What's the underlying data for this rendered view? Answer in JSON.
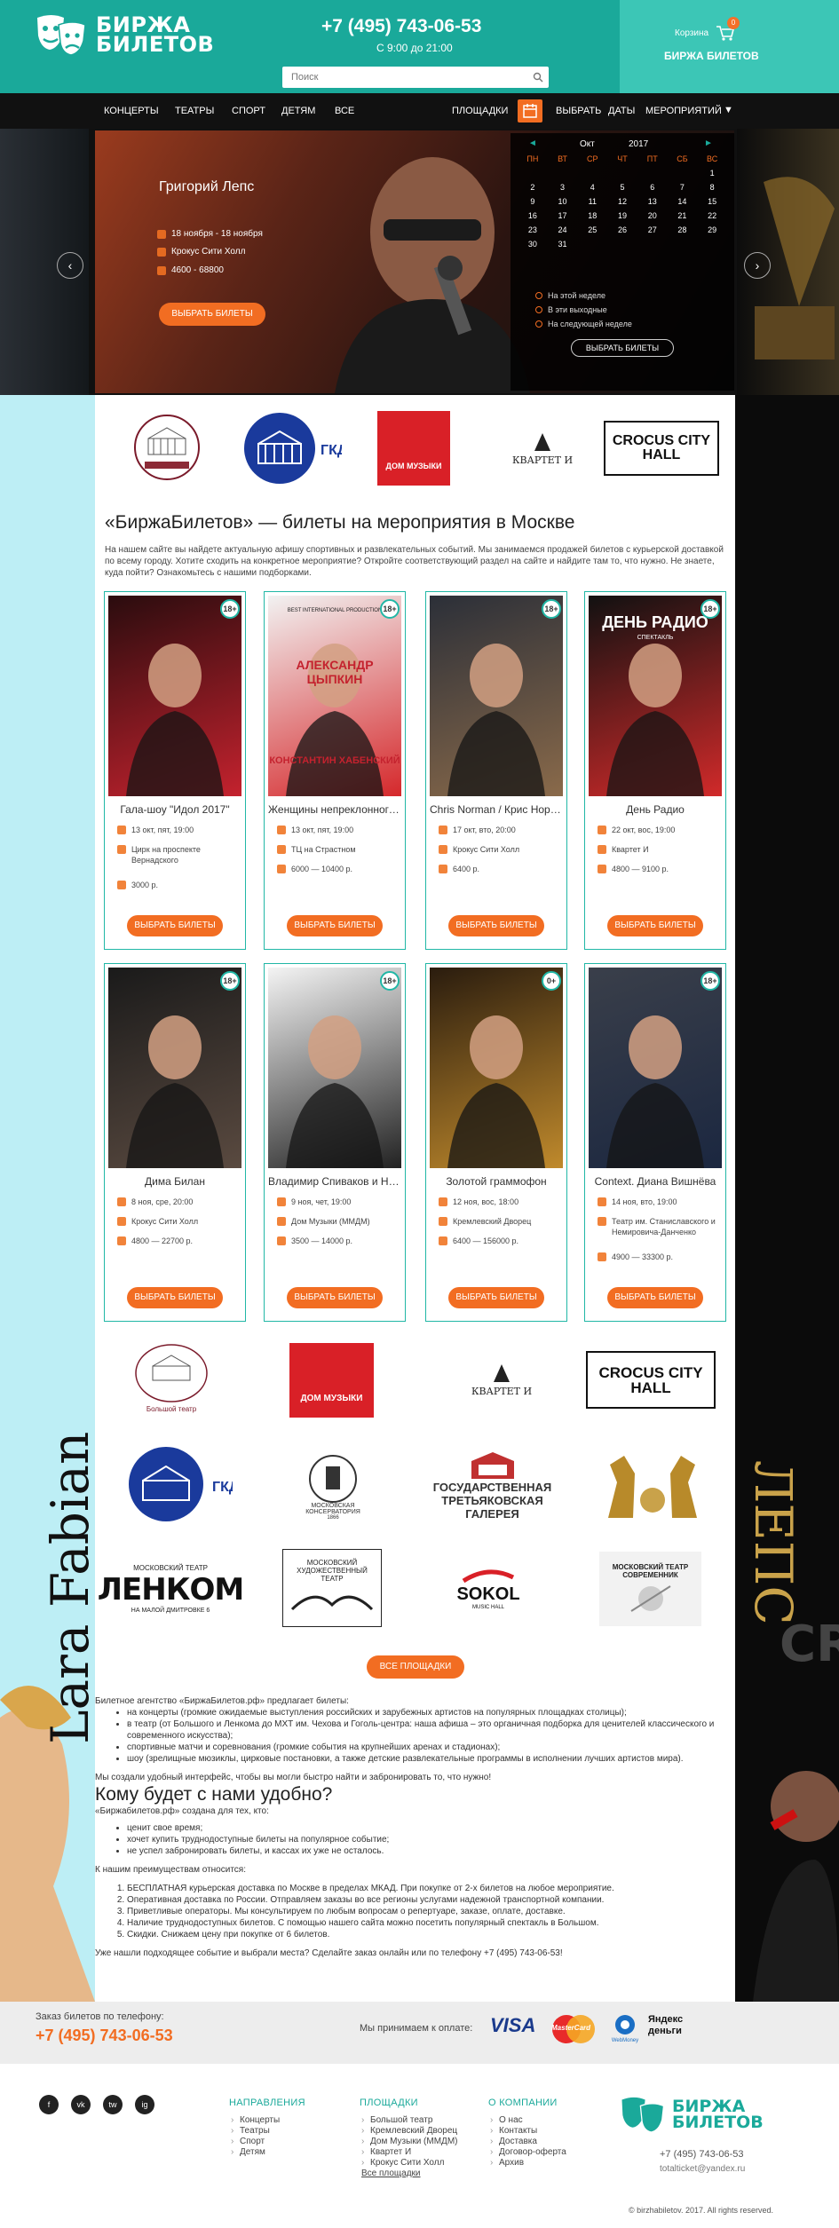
{
  "brand": {
    "name_line1": "БИРЖА",
    "name_line2": "БИЛЕТОВ"
  },
  "header": {
    "phone": "+7 (495) 743-06-53",
    "hours": "С 9:00 до 21:00",
    "search_placeholder": "Поиск",
    "cart_label": "Корзина",
    "cart_count": "0",
    "cart_brand": "БИРЖА БИЛЕТОВ"
  },
  "nav": {
    "items": [
      "КОНЦЕРТЫ",
      "ТЕАТРЫ",
      "СПОРТ",
      "ДЕТЯМ",
      "ВСЕ",
      "ПЛОЩАДКИ"
    ],
    "pick": "ВЫБРАТЬ",
    "dates": "ДАТЫ",
    "events": "МЕРОПРИЯТИЙ"
  },
  "hero": {
    "title": "Григорий Лепс",
    "dates": "18 ноября - 18 ноября",
    "venue": "Крокус Сити Холл",
    "price": "4600 - 68800",
    "button": "ВЫБРАТЬ БИЛЕТЫ"
  },
  "calendar": {
    "month": "Окт",
    "year": "2017",
    "days": [
      "ПН",
      "ВТ",
      "СР",
      "ЧТ",
      "ПТ",
      "СБ",
      "ВС"
    ],
    "cells": [
      "",
      "",
      "",
      "",
      "",
      "",
      "1",
      "2",
      "3",
      "4",
      "5",
      "6",
      "7",
      "8",
      "9",
      "10",
      "11",
      "12",
      "13",
      "14",
      "15",
      "16",
      "17",
      "18",
      "19",
      "20",
      "21",
      "22",
      "23",
      "24",
      "25",
      "26",
      "27",
      "28",
      "29",
      "30",
      "31",
      "",
      "",
      "",
      "",
      ""
    ],
    "options": [
      "На этой неделе",
      "В эти выходные",
      "На следующей неделе"
    ],
    "button": "ВЫБРАТЬ БИЛЕТЫ"
  },
  "venues_top": [
    "Большой театр",
    "ГКД",
    "ДОМ МУЗЫКИ",
    "КВАРТЕТ И",
    "CROCUS CITY HALL"
  ],
  "intro": {
    "heading": "«БиржаБилетов» — билеты на мероприятия в Москве",
    "text": "На нашем сайте вы найдете актуальную афишу спортивных и развлекательных событий. Мы занимаемся продажей билетов с курьерской доставкой по всему городу. Хотите сходить на конкретное мероприятие? Откройте соответствующий раздел на сайте и найдите там то, что нужно. Не знаете, куда пойти? Ознакомьтесь с нашими подборками."
  },
  "cards": [
    {
      "age": "18+",
      "title": "Гала-шоу \"Идол 2017\"",
      "date": "13 окт, пят, 19:00",
      "venue": "Цирк на проспекте Вернадского",
      "price": "3000 р.",
      "button": "ВЫБРАТЬ БИЛЕТЫ"
    },
    {
      "age": "18+",
      "title": "Женщины непреклонного возраста",
      "date": "13 окт, пят, 19:00",
      "venue": "ТЦ на Страстном",
      "price": "6000 — 10400 р.",
      "button": "ВЫБРАТЬ БИЛЕТЫ",
      "poster_top": "BEST INTERNATIONAL PRODUCTION",
      "poster_name": "АЛЕКСАНДР ЦЫПКИН",
      "poster_name2": "КОНСТАНТИН ХАБЕНСКИЙ"
    },
    {
      "age": "18+",
      "title": "Chris Norman / Крис Норман",
      "date": "17 окт, вто, 20:00",
      "venue": "Крокус Сити Холл",
      "price": "6400 р.",
      "button": "ВЫБРАТЬ БИЛЕТЫ"
    },
    {
      "age": "18+",
      "title": "День Радио",
      "date": "22 окт, вос, 19:00",
      "venue": "Квартет И",
      "price": "4800 — 9100 р.",
      "button": "ВЫБРАТЬ БИЛЕТЫ",
      "poster_name": "ДЕНЬ РАДИО",
      "poster_sub": "СПЕКТАКЛЬ"
    },
    {
      "age": "18+",
      "title": "Дима Билан",
      "date": "8 ноя, сре, 20:00",
      "venue": "Крокус Сити Холл",
      "price": "4800 — 22700 р.",
      "button": "ВЫБРАТЬ БИЛЕТЫ"
    },
    {
      "age": "18+",
      "title": "Владимир Спиваков и НФОР",
      "date": "9 ноя, чет, 19:00",
      "venue": "Дом Музыки (ММДМ)",
      "price": "3500 — 14000 р.",
      "button": "ВЫБРАТЬ БИЛЕТЫ"
    },
    {
      "age": "0+",
      "title": "Золотой граммофон",
      "date": "12 ноя, вос, 18:00",
      "venue": "Кремлевский Дворец",
      "price": "6400 — 156000 р.",
      "button": "ВЫБРАТЬ БИЛЕТЫ"
    },
    {
      "age": "18+",
      "title": "Context. Диана Вишнёва",
      "date": "14 ноя, вто, 19:00",
      "venue": "Театр им. Станиславского и Немировича-Данченко",
      "price": "4900 — 33300 р.",
      "button": "ВЫБРАТЬ БИЛЕТЫ"
    }
  ],
  "venues_grid": [
    "Большой театр",
    "ДОМ МУЗЫКИ",
    "КВАРТЕТ И",
    "CROCUS CITY HALL",
    "ГКД",
    "МОСКОВСКАЯ КОНСЕРВАТОРИЯ",
    "ГОСУДАРСТВЕННАЯ ТРЕТЬЯКОВСКАЯ ГАЛЕРЕЯ",
    "",
    "ЛЕНКОМ",
    "МОСКОВСКИЙ ХУДОЖЕСТВЕННЫЙ ТЕАТР",
    "SOKOL",
    "МОСКОВСКИЙ ТЕАТР СОВРЕМЕННИК"
  ],
  "venues_extra": {
    "big_sub": "Большой театр",
    "lenkom_top": "МОСКОВСКИЙ ТЕАТР",
    "lenkom_bottom": "НА МАЛОЙ ДМИТРОВКЕ 6",
    "sokol_sub": "MUSIC HALL",
    "consv_year": "1866"
  },
  "all_venues_button": "ВСЕ ПЛОЩАДКИ",
  "side": {
    "left_text": "Lara Fabian",
    "right_text": "ЛЕПС",
    "right_text2": "CR"
  },
  "article": {
    "p1": "Билетное агентство «БиржаБилетов.рф» предлагает билеты:",
    "list1": [
      "на концерты (громкие ожидаемые выступления российских и зарубежных артистов на популярных площадках столицы);",
      "в театр (от Большого и Ленкома до МХТ им. Чехова и Гоголь-центра: наша афиша – это органичная подборка для ценителей классического и современного искусства);",
      "спортивные матчи и соревнования (громкие события на крупнейших аренах и стадионах);",
      "шоу (зрелищные мюзиклы, цирковые постановки, а также детские развлекательные программы в исполнении лучших артистов мира)."
    ],
    "p2": "Мы создали удобный интерфейс, чтобы вы могли быстро найти и забронировать то, что нужно!",
    "h2": "Кому будет с нами удобно?",
    "p3": "«Биржабилетов.рф» создана для тех, кто:",
    "list2": [
      "ценит свое время;",
      "хочет купить труднодоступные билеты на популярное событие;",
      "не успел забронировать билеты, и кассах их уже не осталось."
    ],
    "p4": "К нашим преимуществам относится:",
    "list3": [
      "БЕСПЛАТНАЯ курьерская доставка по Москве в пределах МКАД. При покупке от 2-х билетов на любое мероприятие.",
      "Оперативная доставка по России. Отправляем заказы во все регионы услугами надежной транспортной компании.",
      "Приветливые операторы. Мы консультируем по любым вопросам о репертуаре, заказе, оплате, доставке.",
      "Наличие труднодоступных билетов. С помощью нашего сайта можно посетить популярный спектакль в Большом.",
      "Скидки. Снижаем цену при покупке от 6 билетов."
    ],
    "p5": "Уже нашли подходящее событие и выбрали места? Сделайте заказ онлайн или по телефону +7 (495) 743-06-53!"
  },
  "order_bar": {
    "label": "Заказ билетов по телефону:",
    "phone": "+7 (495) 743-06-53",
    "pay_label": "Мы принимаем к оплате:",
    "pay_methods": [
      "VISA",
      "MasterCard",
      "WebMoney",
      "Яндекс деньги"
    ]
  },
  "footer": {
    "social": [
      "f",
      "vk",
      "tw",
      "ig"
    ],
    "col1_title": "НАПРАВЛЕНИЯ",
    "col1": [
      "Концерты",
      "Театры",
      "Спорт",
      "Детям"
    ],
    "col2_title": "ПЛОЩАДКИ",
    "col2": [
      "Большой театр",
      "Кремлевский Дворец",
      "Дом Музыки (ММДМ)",
      "Квартет И",
      "Крокус Сити Холл"
    ],
    "col2_more": "Все площадки",
    "col3_title": "О КОМПАНИИ",
    "col3": [
      "О нас",
      "Контакты",
      "Доставка",
      "Договор-оферта",
      "Архив"
    ],
    "phone": "+7 (495) 743-06-53",
    "email": "totalticket@yandex.ru",
    "copyright": "© birzhabiletov. 2017. All rights reserved."
  },
  "colors": {
    "teal": "#1aa99a",
    "orange": "#f26d22",
    "dark": "#111111",
    "light_blue": "#bdeef5"
  }
}
